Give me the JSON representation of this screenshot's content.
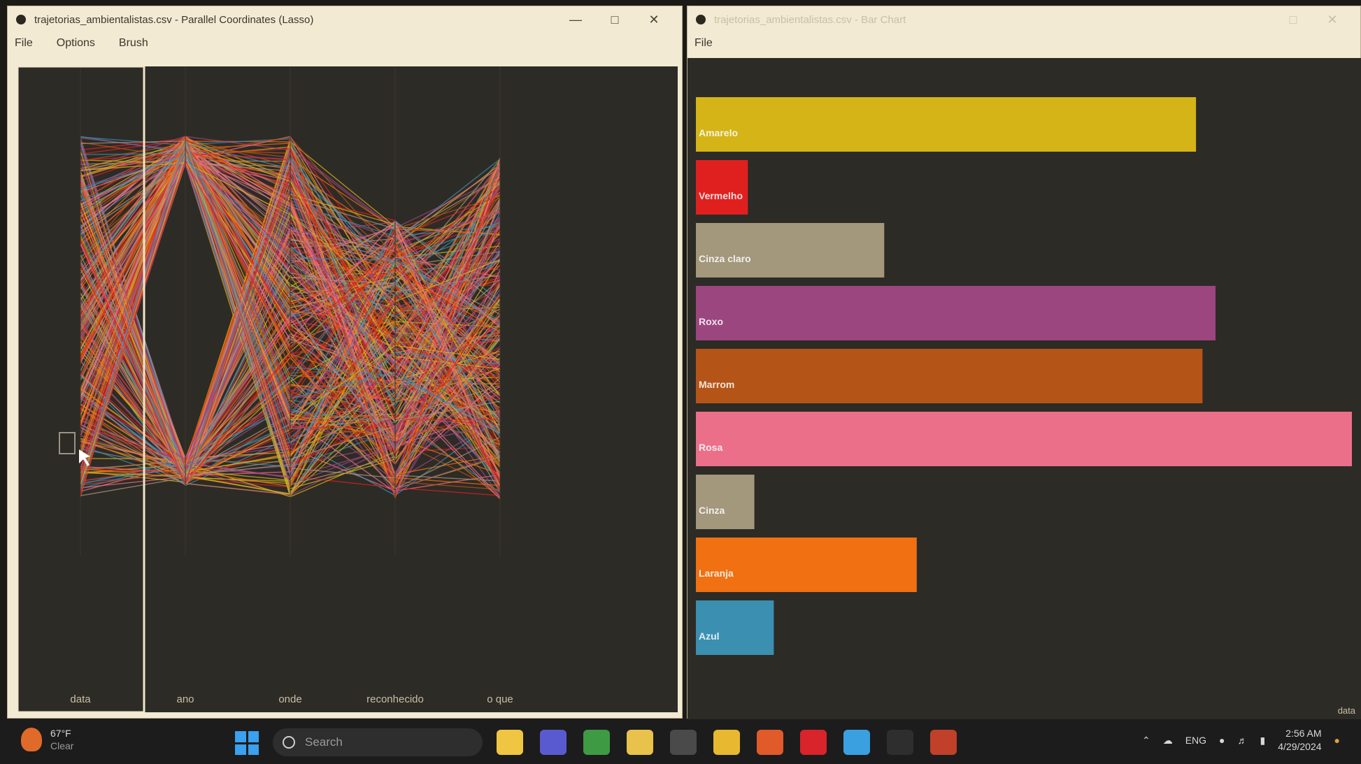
{
  "left_window": {
    "title": "trajetorias_ambientalistas.csv - Parallel Coordinates (Lasso)",
    "menu": [
      "File",
      "Options",
      "Brush"
    ],
    "axes": [
      "data",
      "ano",
      "onde",
      "reconhecido",
      "o que"
    ]
  },
  "right_window": {
    "title": "trajetorias_ambientalistas.csv - Bar Chart",
    "menu": [
      "File"
    ],
    "corner_label": "data"
  },
  "chart_data": [
    {
      "type": "parallel-coordinates",
      "axes": [
        "data",
        "ano",
        "onde",
        "reconhecido",
        "o que"
      ],
      "series_colors": [
        "#d4b417",
        "#e0201f",
        "#a3977c",
        "#9c4680",
        "#b55417",
        "#ec6f8a",
        "#f07012",
        "#3b8fb0"
      ],
      "brush": {
        "axis": "data"
      }
    },
    {
      "type": "bar",
      "orientation": "horizontal",
      "categories": [
        "Amarelo",
        "Vermelho",
        "Cinza claro",
        "Roxo",
        "Marrom",
        "Rosa",
        "Cinza",
        "Laranja",
        "Azul"
      ],
      "values": [
        77,
        8,
        29,
        80,
        78,
        101,
        9,
        34,
        12
      ],
      "colors": [
        "#d4b417",
        "#e0201f",
        "#a3977c",
        "#9c4680",
        "#b55417",
        "#ec6f8a",
        "#a3977c",
        "#f07012",
        "#3b8fb0"
      ],
      "xlim": [
        0,
        101
      ]
    }
  ],
  "taskbar": {
    "weather_temp": "67°F",
    "weather_desc": "Clear",
    "search_placeholder": "Search",
    "lang": "ENG",
    "time": "2:56 AM",
    "date": "4/29/2024",
    "apps": [
      {
        "name": "file-explorer-icon",
        "color": "#f0c542"
      },
      {
        "name": "chat-icon",
        "color": "#5a5ad0"
      },
      {
        "name": "browser-icon",
        "color": "#3f9a44"
      },
      {
        "name": "notes-icon",
        "color": "#e8c24a"
      },
      {
        "name": "terminal-icon",
        "color": "#4a4a4a"
      },
      {
        "name": "folder-icon",
        "color": "#e8b830"
      },
      {
        "name": "firefox-icon",
        "color": "#e05a2a"
      },
      {
        "name": "pdf-icon",
        "color": "#d8242a"
      },
      {
        "name": "editor-icon",
        "color": "#3aa0e0"
      },
      {
        "name": "active-app-icon",
        "color": "#2e2e2e"
      },
      {
        "name": "tool-icon",
        "color": "#c0402a"
      }
    ]
  }
}
